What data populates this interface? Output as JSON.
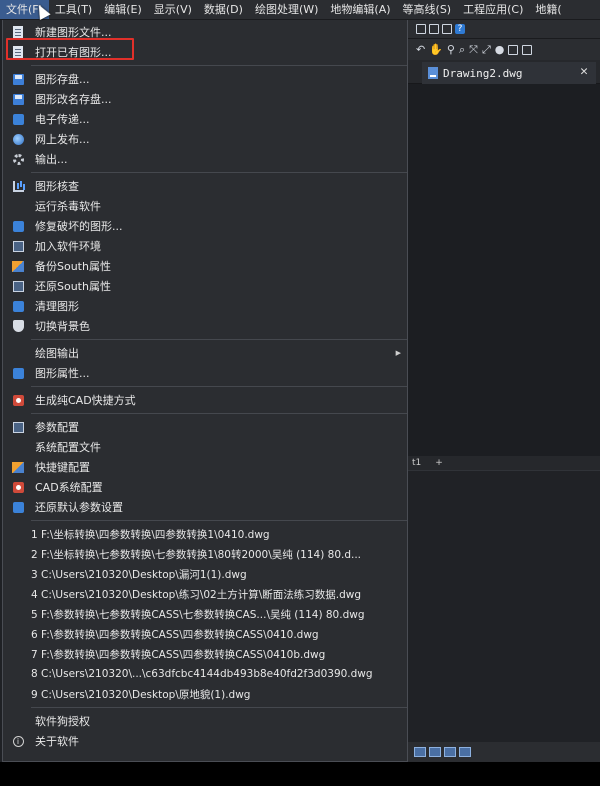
{
  "menubar": {
    "items": [
      "文件(F)",
      "工具(T)",
      "编辑(E)",
      "显示(V)",
      "数据(D)",
      "绘图处理(W)",
      "地物编辑(A)",
      "等高线(S)",
      "工程应用(C)",
      "地籍("
    ]
  },
  "document_tab": {
    "title": "Drawing2.dwg",
    "close": "✕"
  },
  "layout_tabs": {
    "label": "t1",
    "add": "+"
  },
  "file_menu": {
    "group1": [
      "新建图形文件...",
      "打开已有图形..."
    ],
    "group2": [
      "图形存盘...",
      "图形改名存盘...",
      "电子传递...",
      "网上发布...",
      "输出..."
    ],
    "group3": [
      "图形核查",
      "运行杀毒软件",
      "修复破坏的图形...",
      "加入软件环境",
      "备份South属性",
      "还原South属性",
      "清理图形",
      "切换背景色"
    ],
    "group4": [
      "绘图输出",
      "图形属性..."
    ],
    "group5": [
      "生成纯CAD快捷方式"
    ],
    "group6": [
      "参数配置",
      "系统配置文件",
      "快捷键配置",
      "CAD系统配置",
      "还原默认参数设置"
    ],
    "recent_files": [
      "1 F:\\坐标转换\\四参数转换\\四参数转换1\\0410.dwg",
      "2 F:\\坐标转换\\七参数转换\\七参数转换1\\80转2000\\吴纯 (114) 80.d...",
      "3 C:\\Users\\210320\\Desktop\\漏河1(1).dwg",
      "4 C:\\Users\\210320\\Desktop\\练习\\02土方计算\\断面法练习数据.dwg",
      "5 F:\\参数转换\\七参数转换CASS\\七参数转换CAS...\\吴纯 (114) 80.dwg",
      "6 F:\\参数转换\\四参数转换CASS\\四参数转换CASS\\0410.dwg",
      "7 F:\\参数转换\\四参数转换CASS\\四参数转换CASS\\0410b.dwg",
      "8 C:\\Users\\210320\\...\\c63dfcbc4144db493b8e40fd2f3d0390.dwg",
      "9 C:\\Users\\210320\\Desktop\\原地貌(1).dwg"
    ],
    "group8": [
      "软件狗授权",
      "关于软件"
    ]
  },
  "colors": {
    "highlight": "#e0302a",
    "menu_bg": "#2b2d31",
    "accent": "#3b82d9"
  }
}
